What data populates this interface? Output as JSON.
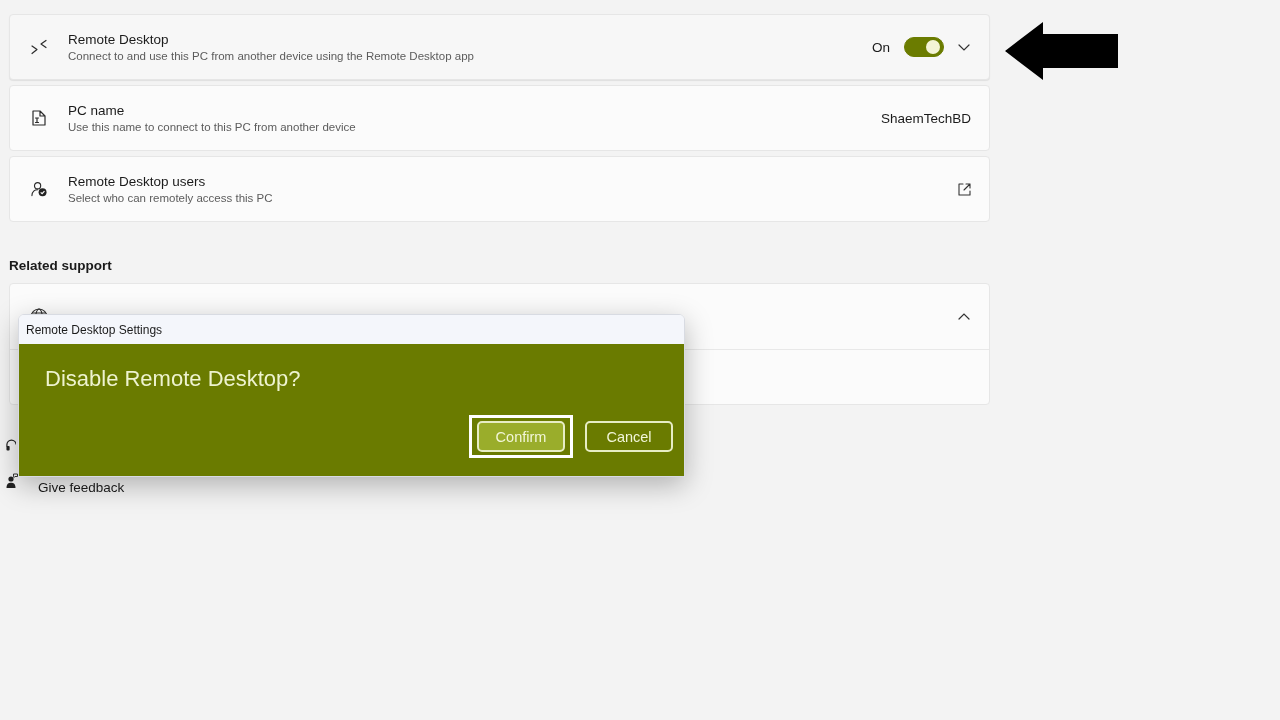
{
  "settings": [
    {
      "kind": "toggle",
      "title": "Remote Desktop",
      "description": "Connect to and use this PC from another device using the Remote Desktop app",
      "state_label": "On",
      "on": true,
      "expanded": false
    },
    {
      "kind": "value",
      "title": "PC name",
      "description": "Use this name to connect to this PC from another device",
      "value": "ShaemTechBD"
    },
    {
      "kind": "link",
      "title": "Remote Desktop users",
      "description": "Select who can remotely access this PC"
    }
  ],
  "related_support": {
    "heading": "Related support",
    "help_card": {
      "expanded": true
    }
  },
  "footer_links": [
    {
      "kind": "help"
    },
    {
      "kind": "feedback",
      "label": "Give feedback"
    }
  ],
  "dialog": {
    "title": "Remote Desktop Settings",
    "message": "Disable Remote Desktop?",
    "buttons": [
      {
        "label": "Confirm",
        "focused": true
      },
      {
        "label": "Cancel",
        "focused": false
      }
    ]
  }
}
